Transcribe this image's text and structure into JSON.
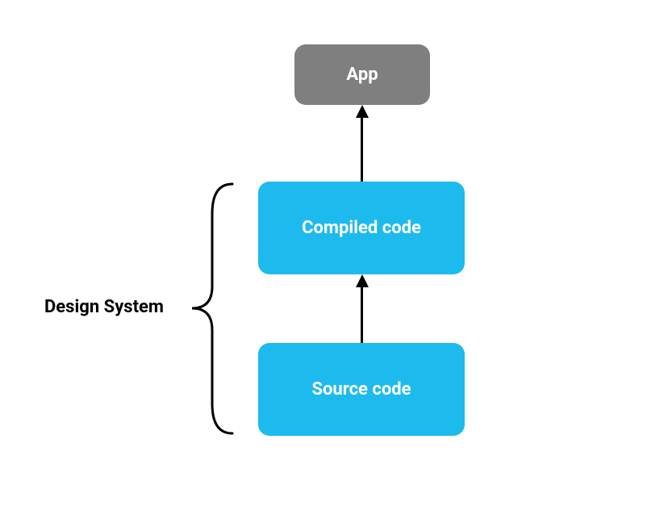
{
  "nodes": {
    "app": {
      "label": "App",
      "color": "#807f7f"
    },
    "compiled": {
      "label": "Compiled code",
      "color": "#1dbaed"
    },
    "source": {
      "label": "Source code",
      "color": "#1dbaed"
    }
  },
  "edges": [
    {
      "from": "compiled",
      "to": "app"
    },
    {
      "from": "source",
      "to": "compiled"
    }
  ],
  "group": {
    "label": "Design System",
    "members": [
      "compiled",
      "source"
    ]
  }
}
